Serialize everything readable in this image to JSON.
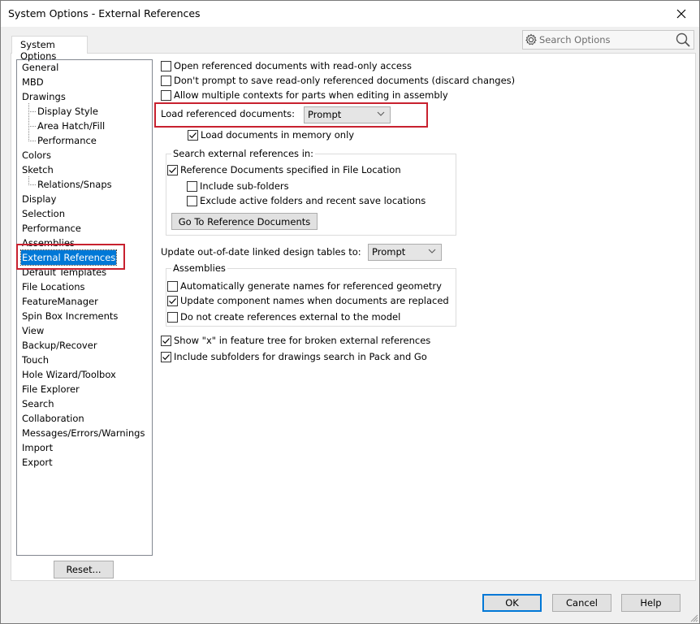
{
  "window": {
    "title": "System Options - External References",
    "close_icon": "close-icon"
  },
  "tabs": [
    {
      "label": "System Options",
      "active": true
    }
  ],
  "search": {
    "placeholder": "Search Options",
    "icon_left": "gear-icon",
    "icon_right": "search-icon"
  },
  "sidebar": {
    "items": [
      {
        "label": "General",
        "level": 0
      },
      {
        "label": "MBD",
        "level": 0
      },
      {
        "label": "Drawings",
        "level": 0
      },
      {
        "label": "Display Style",
        "level": 1
      },
      {
        "label": "Area Hatch/Fill",
        "level": 1
      },
      {
        "label": "Performance",
        "level": 1
      },
      {
        "label": "Colors",
        "level": 0
      },
      {
        "label": "Sketch",
        "level": 0
      },
      {
        "label": "Relations/Snaps",
        "level": 1
      },
      {
        "label": "Display",
        "level": 0
      },
      {
        "label": "Selection",
        "level": 0
      },
      {
        "label": "Performance",
        "level": 0
      },
      {
        "label": "Assemblies",
        "level": 0
      },
      {
        "label": "External References",
        "level": 0,
        "selected": true
      },
      {
        "label": "Default Templates",
        "level": 0
      },
      {
        "label": "File Locations",
        "level": 0
      },
      {
        "label": "FeatureManager",
        "level": 0
      },
      {
        "label": "Spin Box Increments",
        "level": 0
      },
      {
        "label": "View",
        "level": 0
      },
      {
        "label": "Backup/Recover",
        "level": 0
      },
      {
        "label": "Touch",
        "level": 0
      },
      {
        "label": "Hole Wizard/Toolbox",
        "level": 0
      },
      {
        "label": "File Explorer",
        "level": 0
      },
      {
        "label": "Search",
        "level": 0
      },
      {
        "label": "Collaboration",
        "level": 0
      },
      {
        "label": "Messages/Errors/Warnings",
        "level": 0
      },
      {
        "label": "Import",
        "level": 0
      },
      {
        "label": "Export",
        "level": 0
      }
    ],
    "reset_label": "Reset..."
  },
  "options": {
    "open_readonly": {
      "label": "Open referenced documents with read-only access",
      "checked": false
    },
    "dont_prompt_save": {
      "label": "Don't prompt to save read-only referenced documents (discard changes)",
      "checked": false
    },
    "allow_multiple_contexts": {
      "label": "Allow multiple contexts for parts when editing in assembly",
      "checked": false
    },
    "load_referenced": {
      "label": "Load referenced documents:",
      "value": "Prompt"
    },
    "load_in_memory": {
      "label": "Load documents in memory only",
      "checked": true
    },
    "search_group": {
      "title": "Search external references in:",
      "reference_docs": {
        "label": "Reference Documents specified in File Location",
        "checked": true
      },
      "include_subfolders": {
        "label": "Include sub-folders",
        "checked": false
      },
      "exclude_active": {
        "label": "Exclude active folders and recent save locations",
        "checked": false
      },
      "goto_button": "Go To Reference Documents"
    },
    "update_design_tables": {
      "label": "Update out-of-date linked design tables to:",
      "value": "Prompt"
    },
    "assemblies_group": {
      "title": "Assemblies",
      "auto_generate_names": {
        "label": "Automatically generate names for referenced geometry",
        "checked": false
      },
      "update_component_names": {
        "label": "Update component names when documents are replaced",
        "checked": true
      },
      "no_external_refs": {
        "label": "Do not create references external to the model",
        "checked": false
      }
    },
    "show_x_broken": {
      "label": "Show \"x\" in feature tree for broken external references",
      "checked": true
    },
    "include_subfolders_pack_go": {
      "label": "Include subfolders for drawings search in Pack and Go",
      "checked": true
    }
  },
  "footer": {
    "ok": "OK",
    "cancel": "Cancel",
    "help": "Help"
  },
  "colors": {
    "selection": "#0078d7",
    "highlight_box": "#c8212f"
  }
}
